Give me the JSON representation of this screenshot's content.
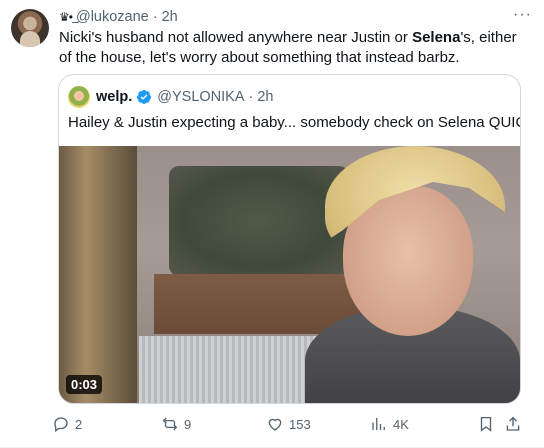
{
  "tweet": {
    "author_emoji": "♛•͢",
    "handle": "@lukozane",
    "separator": "·",
    "time": "2h",
    "text_before": "Nicki's husband not allowed anywhere near Justin or ",
    "text_bold": "Selena",
    "text_after": "'s, either of the house, let's worry about something that instead barbz.",
    "more_label": "···"
  },
  "quote": {
    "name": "welp.",
    "handle": "@YSLONIKA",
    "separator": "·",
    "time": "2h",
    "text": "Hailey & Justin expecting a baby... somebody check on Selena QUICK.",
    "video_duration": "0:03"
  },
  "actions": {
    "replies": "2",
    "reposts": "9",
    "likes": "153",
    "views": "4K"
  },
  "colors": {
    "text_primary": "#0f1419",
    "text_secondary": "#536471",
    "verified_blue": "#1d9bf0",
    "border": "#cfd9de"
  }
}
